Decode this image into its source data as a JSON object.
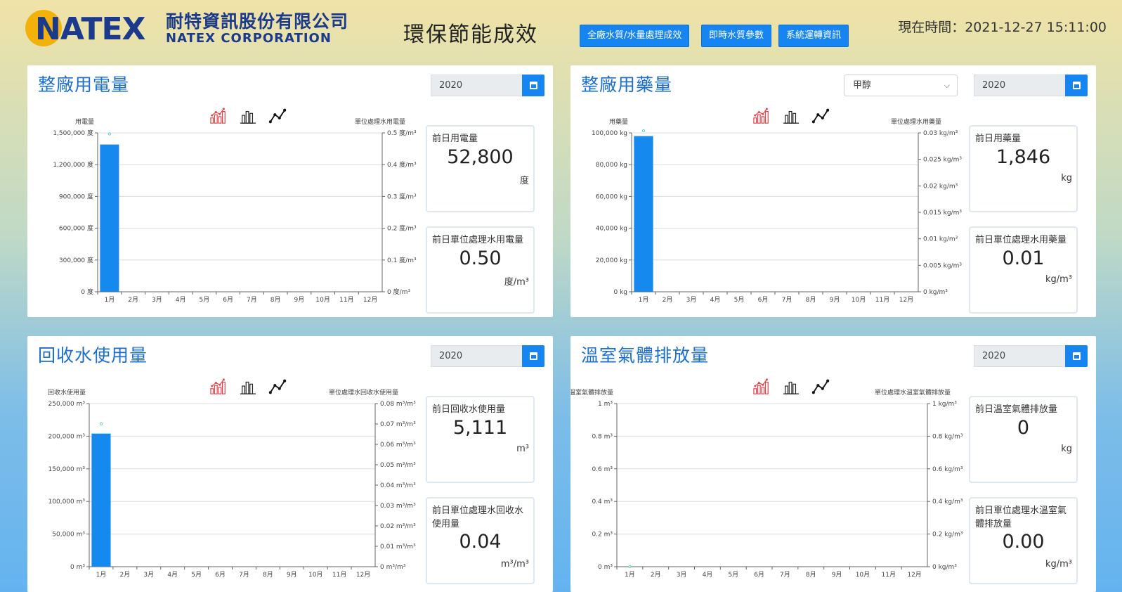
{
  "header": {
    "logo_text": "NATEX",
    "company_cn": "耐特資訊股份有限公司",
    "company_en": "NATEX CORPORATION",
    "page_title": "環保節能成效",
    "nav": [
      "全廠水質/水量處理成效",
      "即時水質參數",
      "系統運轉資訊"
    ],
    "clock_label": "現在時間：",
    "clock_value": "2021-12-27 15:11:00"
  },
  "panels": [
    {
      "title": "整廠用電量",
      "year": "2020",
      "card1": {
        "label": "前日用電量",
        "value": "52,800",
        "unit": "度"
      },
      "card2": {
        "label": "前日單位處理水用電量",
        "value": "0.50",
        "unit": "度/m³"
      }
    },
    {
      "title": "整廠用藥量",
      "select": "甲醇",
      "year": "2020",
      "card1": {
        "label": "前日用藥量",
        "value": "1,846",
        "unit": "kg"
      },
      "card2": {
        "label": "前日單位處理水用藥量",
        "value": "0.01",
        "unit": "kg/m³"
      }
    },
    {
      "title": "回收水使用量",
      "year": "2020",
      "card1": {
        "label": "前日回收水使用量",
        "value": "5,111",
        "unit": "m³"
      },
      "card2": {
        "label": "前日單位處理水回收水使用量",
        "value": "0.04",
        "unit": "m³/m³"
      }
    },
    {
      "title": "溫室氣體排放量",
      "year": "2020",
      "card1": {
        "label": "前日溫室氣體排放量",
        "value": "0",
        "unit": "kg"
      },
      "card2": {
        "label": "前日單位處理水溫室氣體排放量",
        "value": "0.00",
        "unit": "kg/m³"
      }
    }
  ],
  "icons": {
    "chart_toggle": [
      "bar-line-icon",
      "bar-chart-icon",
      "line-chart-icon"
    ],
    "year_button": "calendar-icon",
    "select_chevron": "chevron-down-icon"
  },
  "colors": {
    "bar": "#1589ee",
    "line_point": "#5fd3c9",
    "accent": "#1685f2",
    "title": "#1b6fcf",
    "logo_blue": "#1b3a8c",
    "logo_gold": "#f3b20a"
  },
  "chart_data": [
    {
      "type": "bar",
      "title": "",
      "categories": [
        "1月",
        "2月",
        "3月",
        "4月",
        "5月",
        "6月",
        "7月",
        "8月",
        "9月",
        "10月",
        "11月",
        "12月"
      ],
      "ylabel": "用電量",
      "y2label": "單位處理水用電量",
      "ylim": [
        0,
        1500000
      ],
      "y2lim": [
        0,
        0.5
      ],
      "yticks": [
        "0 度",
        "300,000 度",
        "600,000 度",
        "900,000 度",
        "1,200,000 度",
        "1,500,000 度"
      ],
      "y2ticks": [
        "0 度/m³",
        "0.1 度/m³",
        "0.2 度/m³",
        "0.3 度/m³",
        "0.4 度/m³",
        "0.5 度/m³"
      ],
      "series": [
        {
          "values": [
            1390000,
            null,
            null,
            null,
            null,
            null,
            null,
            null,
            null,
            null,
            null,
            null
          ],
          "type": "bar",
          "axis": "left"
        },
        {
          "values": [
            0.49,
            null,
            null,
            null,
            null,
            null,
            null,
            null,
            null,
            null,
            null,
            null
          ],
          "type": "line",
          "axis": "right"
        }
      ],
      "grid": true
    },
    {
      "type": "bar",
      "title": "",
      "categories": [
        "1月",
        "2月",
        "3月",
        "4月",
        "5月",
        "6月",
        "7月",
        "8月",
        "9月",
        "10月",
        "11月",
        "12月"
      ],
      "ylabel": "用藥量",
      "y2label": "單位處理水用藥量",
      "ylim": [
        0,
        100000
      ],
      "y2lim": [
        0,
        0.03
      ],
      "yticks": [
        "0 kg",
        "20,000 kg",
        "40,000 kg",
        "60,000 kg",
        "80,000 kg",
        "100,000 kg"
      ],
      "y2ticks": [
        "0 kg/m³",
        "0.005 kg/m³",
        "0.01 kg/m³",
        "0.015 kg/m³",
        "0.02 kg/m³",
        "0.025 kg/m³",
        "0.03 kg/m³"
      ],
      "series": [
        {
          "values": [
            98000,
            null,
            null,
            null,
            null,
            null,
            null,
            null,
            null,
            null,
            null,
            null
          ],
          "type": "bar",
          "axis": "left"
        },
        {
          "values": [
            0.03,
            null,
            null,
            null,
            null,
            null,
            null,
            null,
            null,
            null,
            null,
            null
          ],
          "type": "line",
          "axis": "right"
        }
      ],
      "grid": true
    },
    {
      "type": "bar",
      "title": "",
      "categories": [
        "1月",
        "2月",
        "3月",
        "4月",
        "5月",
        "6月",
        "7月",
        "8月",
        "9月",
        "10月",
        "11月",
        "12月"
      ],
      "ylabel": "回收水使用量",
      "y2label": "單位處理水回收水使用量",
      "ylim": [
        0,
        250000
      ],
      "y2lim": [
        0,
        0.08
      ],
      "yticks": [
        "0 m³",
        "50,000 m³",
        "100,000 m³",
        "150,000 m³",
        "200,000 m³",
        "250,000 m³"
      ],
      "y2ticks": [
        "0 m³/m³",
        "0.01 m³/m³",
        "0.02 m³/m³",
        "0.03 m³/m³",
        "0.04 m³/m³",
        "0.05 m³/m³",
        "0.06 m³/m³",
        "0.07 m³/m³",
        "0.08 m³/m³"
      ],
      "series": [
        {
          "values": [
            204000,
            null,
            null,
            null,
            null,
            null,
            null,
            null,
            null,
            null,
            null,
            null
          ],
          "type": "bar",
          "axis": "left"
        },
        {
          "values": [
            0.069,
            null,
            null,
            null,
            null,
            null,
            null,
            null,
            null,
            null,
            null,
            null
          ],
          "type": "line",
          "axis": "right"
        }
      ],
      "grid": true
    },
    {
      "type": "bar",
      "title": "",
      "categories": [
        "1月",
        "2月",
        "3月",
        "4月",
        "5月",
        "6月",
        "7月",
        "8月",
        "9月",
        "10月",
        "11月",
        "12月"
      ],
      "ylabel": "溫室氣體排放量",
      "y2label": "單位處理水溫室氣體排放量",
      "ylim": [
        0,
        1
      ],
      "y2lim": [
        0,
        1
      ],
      "yticks": [
        "0 m³",
        "0.2 m³",
        "0.4 m³",
        "0.6 m³",
        "0.8 m³",
        "1 m³"
      ],
      "y2ticks": [
        "0 kg/m³",
        "0.2 kg/m³",
        "0.4 kg/m³",
        "0.6 kg/m³",
        "0.8 kg/m³",
        "1 kg/m³"
      ],
      "series": [
        {
          "values": [
            0,
            null,
            null,
            null,
            null,
            null,
            null,
            null,
            null,
            null,
            null,
            null
          ],
          "type": "bar",
          "axis": "left"
        },
        {
          "values": [
            0,
            null,
            null,
            null,
            null,
            null,
            null,
            null,
            null,
            null,
            null,
            null
          ],
          "type": "line",
          "axis": "right"
        }
      ],
      "grid": true
    }
  ]
}
